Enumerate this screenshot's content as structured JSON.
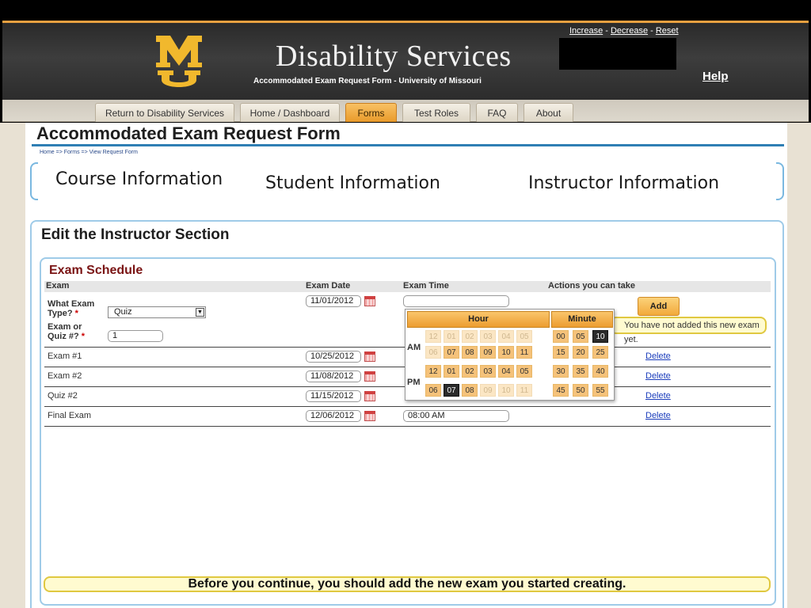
{
  "header": {
    "site_title": "Disability Services",
    "site_subtitle": "Accommodated Exam Request Form - University of Missouri",
    "font_controls": {
      "increase": "Increase",
      "sep1": " - ",
      "decrease": "Decrease",
      "sep2": " - ",
      "reset": "Reset"
    },
    "help_label": "Help"
  },
  "nav": {
    "tabs": [
      {
        "label": "Return to Disability Services",
        "active": false
      },
      {
        "label": "Home / Dashboard",
        "active": false
      },
      {
        "label": "Forms",
        "active": true
      },
      {
        "label": "Test Roles",
        "active": false
      },
      {
        "label": "FAQ",
        "active": false
      },
      {
        "label": "About",
        "active": false
      }
    ]
  },
  "page": {
    "title": "Accommodated Exam Request Form",
    "breadcrumb": "Home => Forms => View Request Form",
    "section_tabs": [
      "Course Information",
      "Student Information",
      "Instructor Information"
    ],
    "edit_title": "Edit the Instructor Section"
  },
  "schedule": {
    "title": "Exam Schedule",
    "columns": [
      "Exam",
      "Exam Date",
      "Exam Time",
      "Actions you can take"
    ],
    "new_exam": {
      "type_label": "What Exam Type?",
      "type_value": "Quiz",
      "number_label": "Exam or Quiz #?",
      "number_value": "1",
      "date_value": "11/01/2012",
      "time_value": "",
      "add_label": "Add",
      "warning": "You have not added this new exam yet."
    },
    "rows": [
      {
        "exam": "Exam #1",
        "date": "10/25/2012",
        "time": "",
        "action": "Delete"
      },
      {
        "exam": "Exam #2",
        "date": "11/08/2012",
        "time": "",
        "action": "Delete"
      },
      {
        "exam": "Quiz #2",
        "date": "11/15/2012",
        "time": "",
        "action": "Delete"
      },
      {
        "exam": "Final Exam",
        "date": "12/06/2012",
        "time": "08:00 AM",
        "action": "Delete"
      }
    ]
  },
  "time_picker": {
    "hour_label": "Hour",
    "minute_label": "Minute",
    "am_label": "AM",
    "pm_label": "PM",
    "am_rows": [
      [
        "12",
        "01",
        "02",
        "03",
        "04",
        "05"
      ],
      [
        "06",
        "07",
        "08",
        "09",
        "10",
        "11"
      ]
    ],
    "pm_rows": [
      [
        "12",
        "01",
        "02",
        "03",
        "04",
        "05"
      ],
      [
        "06",
        "07",
        "08",
        "09",
        "10",
        "11"
      ]
    ],
    "minute_rows": [
      [
        "00",
        "05",
        "10"
      ],
      [
        "15",
        "20",
        "25"
      ],
      [
        "30",
        "35",
        "40"
      ],
      [
        "45",
        "50",
        "55"
      ]
    ],
    "selected_hour": "07 PM",
    "selected_minute": "10"
  },
  "continue_message": "Before you continue, you should add the new exam you started creating.",
  "colors": {
    "accent_orange": "#f2a93b",
    "header_dark": "#333333",
    "panel_blue": "#9fcbe8",
    "section_red": "#7a1414"
  }
}
